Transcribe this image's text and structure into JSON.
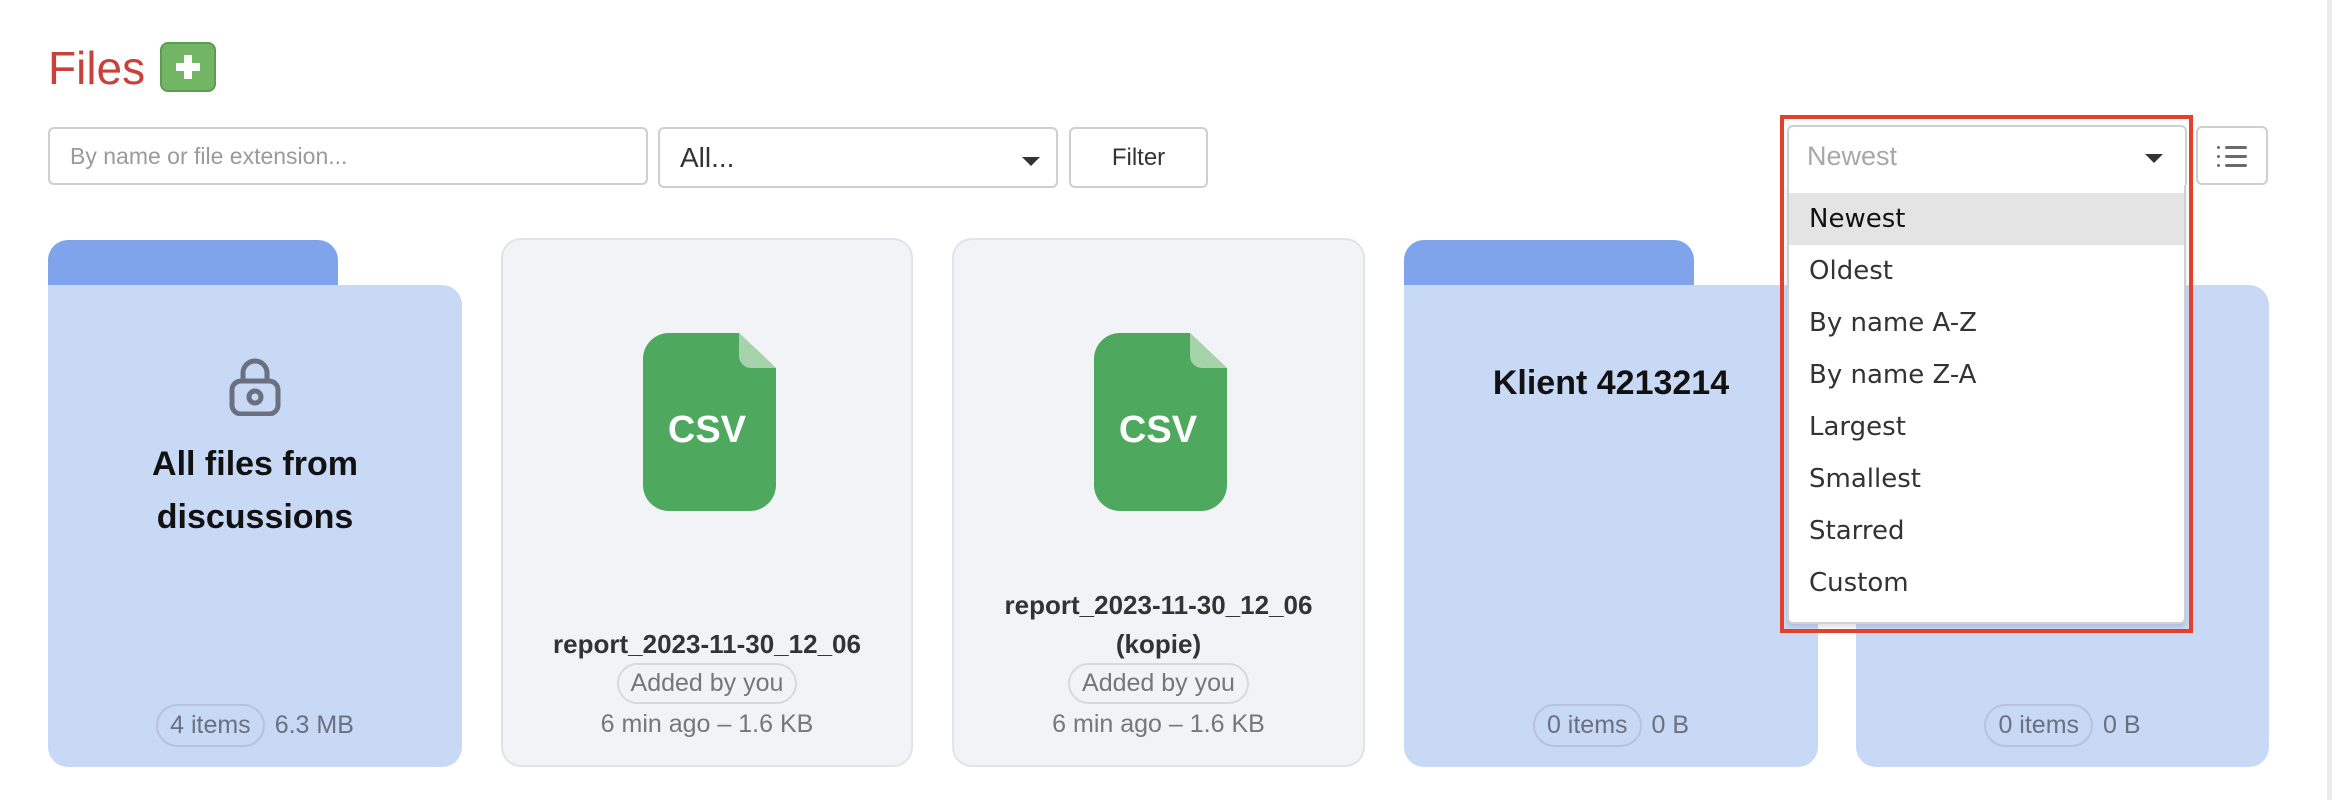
{
  "header": {
    "title": "Files",
    "add_button_icon": "plus-icon"
  },
  "toolbar": {
    "search_placeholder": "By name or file extension...",
    "search_value": "",
    "type_filter_value": "All...",
    "filter_label": "Filter",
    "sort_value": "Newest",
    "view_toggle_icon": "list-icon"
  },
  "sort_menu": {
    "selected": "Newest",
    "options": [
      "Newest",
      "Oldest",
      "By name A-Z",
      "By name Z-A",
      "Largest",
      "Smallest",
      "Starred",
      "Custom"
    ]
  },
  "colors": {
    "title": "#c8423b",
    "add_button": "#72b564",
    "folder_tab": "#80a4ec",
    "folder_body": "#c8d9f6",
    "file_card": "#f2f3f7",
    "csv_icon": "#4ea95e",
    "highlight_box": "#e5402c"
  },
  "items": [
    {
      "type": "folder",
      "title_line1": "All files from",
      "title_line2": "discussions",
      "icon": "lock-icon",
      "count": "4 items",
      "size": "6.3 MB"
    },
    {
      "type": "file",
      "ext": "CSV",
      "name_line1": "report_2023-11-30_12_06",
      "name_line2": "",
      "added_by": "Added by you",
      "meta": "6 min ago – 1.6 KB"
    },
    {
      "type": "file",
      "ext": "CSV",
      "name_line1": "report_2023-11-30_12_06",
      "name_line2": "(kopie)",
      "added_by": "Added by you",
      "meta": "6 min ago – 1.6 KB"
    },
    {
      "type": "folder",
      "title_line1": "Klient 4213214",
      "count": "0 items",
      "size": "0 B"
    },
    {
      "type": "folder",
      "title_line1": "",
      "count": "0 items",
      "size": "0 B"
    }
  ]
}
